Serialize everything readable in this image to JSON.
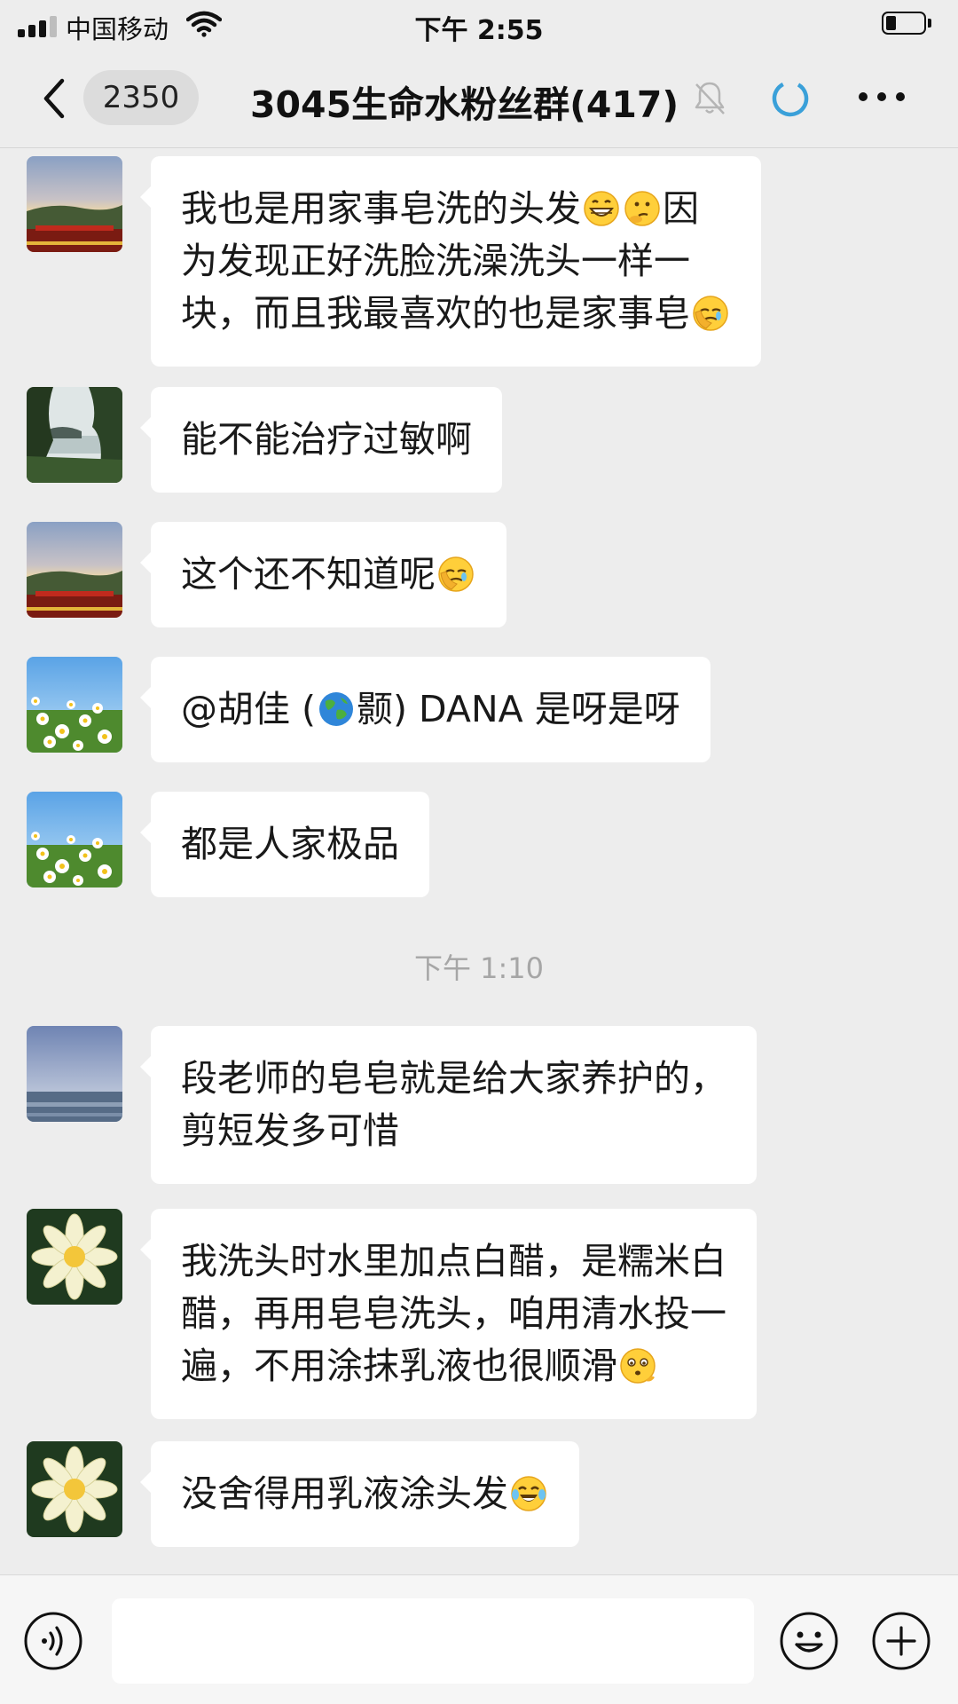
{
  "status_bar": {
    "carrier": "中国移动",
    "time": "下午 2:55",
    "battery_level": 0.2
  },
  "nav": {
    "unread_count": "2350",
    "title": "3045生命水粉丝群(417)",
    "icons": [
      "back-chevron-icon",
      "mute-bell-icon",
      "loading-ring-icon",
      "more-dots-icon"
    ]
  },
  "messages": [
    {
      "avatar": "sunset-sky-avatar",
      "lines": [
        {
          "text": "我也是用家事皂洗的头发",
          "emoji": [
            "grin-emoji",
            "thinking-emoji"
          ],
          "tail": "因"
        },
        {
          "text": "为发现正好洗脸洗澡洗头一样一"
        },
        {
          "text": "块，而且我最喜欢的也是家事皂",
          "emoji": [
            "facepalm-emoji"
          ]
        }
      ]
    },
    {
      "avatar": "forest-lake-avatar",
      "lines": [
        {
          "text": "能不能治疗过敏啊"
        }
      ]
    },
    {
      "avatar": "sunset-sky-avatar",
      "lines": [
        {
          "text": "这个还不知道呢",
          "emoji": [
            "facepalm-emoji"
          ]
        }
      ]
    },
    {
      "avatar": "daisy-field-avatar",
      "lines": [
        {
          "text": "@胡佳 (",
          "emoji": [
            "globe-emoji"
          ],
          "tail": "颢) DANA 是呀是呀"
        }
      ]
    },
    {
      "avatar": "daisy-field-avatar",
      "lines": [
        {
          "text": "都是人家极品"
        }
      ]
    },
    {
      "avatar": "sea-horizon-avatar",
      "lines": [
        {
          "text": "段老师的皂皂就是给大家养护的，"
        },
        {
          "text": "剪短发多可惜"
        }
      ]
    },
    {
      "avatar": "lotus-flower-avatar",
      "lines": [
        {
          "text": "我洗头时水里加点白醋，是糯米白"
        },
        {
          "text": "醋，再用皂皂洗头，咱用清水投一"
        },
        {
          "text": "遍，不用涂抹乳液也很顺滑",
          "emoji": [
            "shy-emoji"
          ]
        }
      ]
    },
    {
      "avatar": "lotus-flower-avatar",
      "lines": [
        {
          "text": "没舍得用乳液涂头发",
          "emoji": [
            "tears-of-joy-emoji"
          ]
        }
      ]
    }
  ],
  "time_divider": "下午 1:10",
  "input_bar": {
    "placeholder": "",
    "icons": [
      "voice-icon",
      "emoji-icon",
      "plus-icon"
    ]
  },
  "colors": {
    "background": "#ededed",
    "bubble": "#ffffff",
    "text": "#191919",
    "timestamp": "#a6a6a6",
    "loading_ring": "#3aa0d9"
  }
}
